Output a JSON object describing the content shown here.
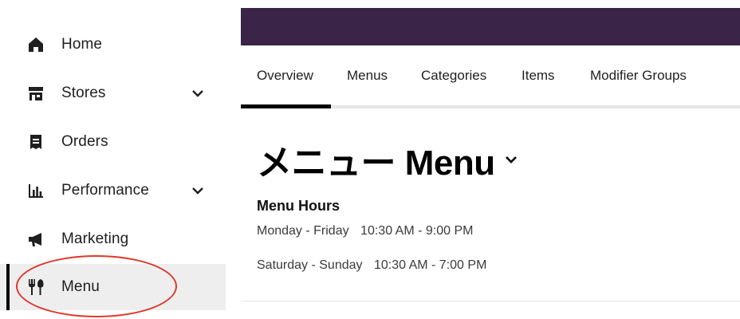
{
  "sidebar": {
    "items": [
      {
        "label": "Home",
        "icon": "home-icon",
        "has_chevron": false,
        "active": false
      },
      {
        "label": "Stores",
        "icon": "store-icon",
        "has_chevron": true,
        "active": false
      },
      {
        "label": "Orders",
        "icon": "orders-icon",
        "has_chevron": false,
        "active": false
      },
      {
        "label": "Performance",
        "icon": "bar-chart-icon",
        "has_chevron": true,
        "active": false
      },
      {
        "label": "Marketing",
        "icon": "megaphone-icon",
        "has_chevron": false,
        "active": false
      },
      {
        "label": "Menu",
        "icon": "fork-knife-icon",
        "has_chevron": false,
        "active": true
      }
    ]
  },
  "tabs": [
    {
      "label": "Overview",
      "active": true
    },
    {
      "label": "Menus",
      "active": false
    },
    {
      "label": "Categories",
      "active": false
    },
    {
      "label": "Items",
      "active": false
    },
    {
      "label": "Modifier Groups",
      "active": false
    }
  ],
  "main": {
    "title": "メニュー Menu",
    "hours_heading": "Menu Hours",
    "hours": [
      {
        "days": "Monday - Friday",
        "time": "10:30 AM - 9:00 PM"
      },
      {
        "days": "Saturday - Sunday",
        "time": "10:30 AM - 7:00 PM"
      }
    ]
  },
  "colors": {
    "topbar": "#3a2548",
    "annotation": "#e0372c",
    "active_bg": "#eeeeee"
  }
}
